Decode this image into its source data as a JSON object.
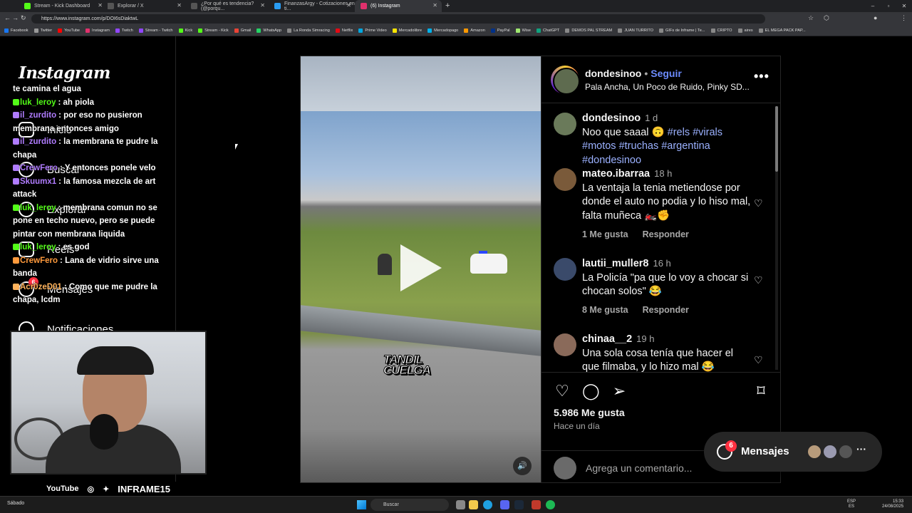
{
  "browser": {
    "tabs": [
      {
        "label": "Stream - Kick Dashboard",
        "color": "#53fc18"
      },
      {
        "label": "Explorar / X",
        "color": "#000000"
      },
      {
        "label": "¿Por qué es tendencia? (@porqu...",
        "color": "#000000"
      },
      {
        "label": "FinanzasArgy - Cotizaciones en ti...",
        "color": "#2a9df4"
      },
      {
        "label": "(6) Instagram",
        "color": "#e1306c"
      }
    ],
    "url": "https://www.instagram.com/p/DOI6sDiaktwL",
    "bookmarks": [
      "Facebook",
      "Twitter",
      "YouTube",
      "Instagram",
      "Twitch",
      "Stream - Twitch",
      "Kick",
      "Stream - Kick",
      "Gmail",
      "WhatsApp",
      "La Ronda Simracing",
      "Netflix",
      "Prime Video",
      "Mercadolibre",
      "Mercadopago",
      "Amazon",
      "PayPal",
      "Wise",
      "ChatGPT",
      "DEMOS PAL STREAM",
      "JUAN TURRITO",
      "GIFs de Inframe | Te...",
      "CRIPTO",
      "aires",
      "EL MEGA PACK PAP..."
    ]
  },
  "instagram": {
    "logo": "Instagram",
    "nav": [
      "Inicio",
      "Buscar",
      "Explorar",
      "Reels",
      "Mensajes",
      "Notificaciones"
    ],
    "nav_badge": "6"
  },
  "chat": {
    "lines": [
      {
        "user": "",
        "text": "te camina el agua",
        "color": "#ffffff"
      },
      {
        "user": "luk_leroy",
        "text": ": ah piola",
        "color": "#53fc18"
      },
      {
        "user": "il_zurdito",
        "text": ": por eso no pusieron membrana entonces amigo",
        "color": "#b07cff"
      },
      {
        "user": "il_zurdito",
        "text": ": la membrana te pudre la chapa",
        "color": "#b07cff"
      },
      {
        "user": "CrewFero",
        "text": ": Y entonces ponele velo",
        "color": "#b07cff"
      },
      {
        "user": "Skuumx1",
        "text": ": la famosa mezcla de art attack",
        "color": "#b07cff"
      },
      {
        "user": "luk_leroy",
        "text": ": membrana comun no se pone en techo nuevo, pero se puede pintar con membrana liquida",
        "color": "#53fc18"
      },
      {
        "user": "luk_leroy",
        "text": ": es god",
        "color": "#53fc18"
      },
      {
        "user": "CrewFero",
        "text": ": Lana de vidrio sirve una banda",
        "color": "#ff9a3c"
      },
      {
        "user": "Acr0zeD01",
        "text": ": Como que me pudre la chapa, lcdm",
        "color": "#ffb35c"
      }
    ]
  },
  "stream": {
    "social": [
      "YouTube",
      "INFRAME15"
    ]
  },
  "post": {
    "username": "dondesinoo",
    "follow": "Seguir",
    "music": "Pala Ancha, Un Poco de Ruido, Pinky SD...",
    "video_watermark": "TANDIL CUELGA",
    "caption": {
      "user": "dondesinoo",
      "time": "1 d",
      "text": "Noo que saaal 🙃",
      "tags": "#rels #virals #motos #truchas #argentina #dondesinoo"
    },
    "comments": [
      {
        "user": "mateo.ibarraa",
        "time": "18 h",
        "text": "La ventaja la tenia metiendose por donde el auto no podia y lo hiso mal, falta muñeca 🏍️✊",
        "likes": "1 Me gusta",
        "reply": "Responder"
      },
      {
        "user": "lautii_muller8",
        "time": "16 h",
        "text": "La Policía \"pa que lo voy a chocar si chocan solos\" 😂",
        "likes": "8 Me gusta",
        "reply": "Responder"
      },
      {
        "user": "chinaa__2",
        "time": "19 h",
        "text": "Una sola cosa tenía que hacer el que filmaba, y lo hizo mal 😂",
        "likes": "",
        "reply": ""
      }
    ],
    "like_count": "5.986 Me gusta",
    "date": "Hace un día",
    "add_comment_placeholder": "Agrega un comentario..."
  },
  "messages_pill": {
    "label": "Mensajes",
    "badge": "6"
  },
  "taskbar": {
    "weather": "Sábado",
    "search": "Buscar",
    "lang_line1": "ESP",
    "lang_line2": "ES",
    "time": "15:33",
    "date": "24/08/2025"
  },
  "colors": {
    "ig_blue": "#0095f6",
    "ig_link": "#6c8cff",
    "kick_green": "#53fc18",
    "badge_red": "#ff3040"
  }
}
